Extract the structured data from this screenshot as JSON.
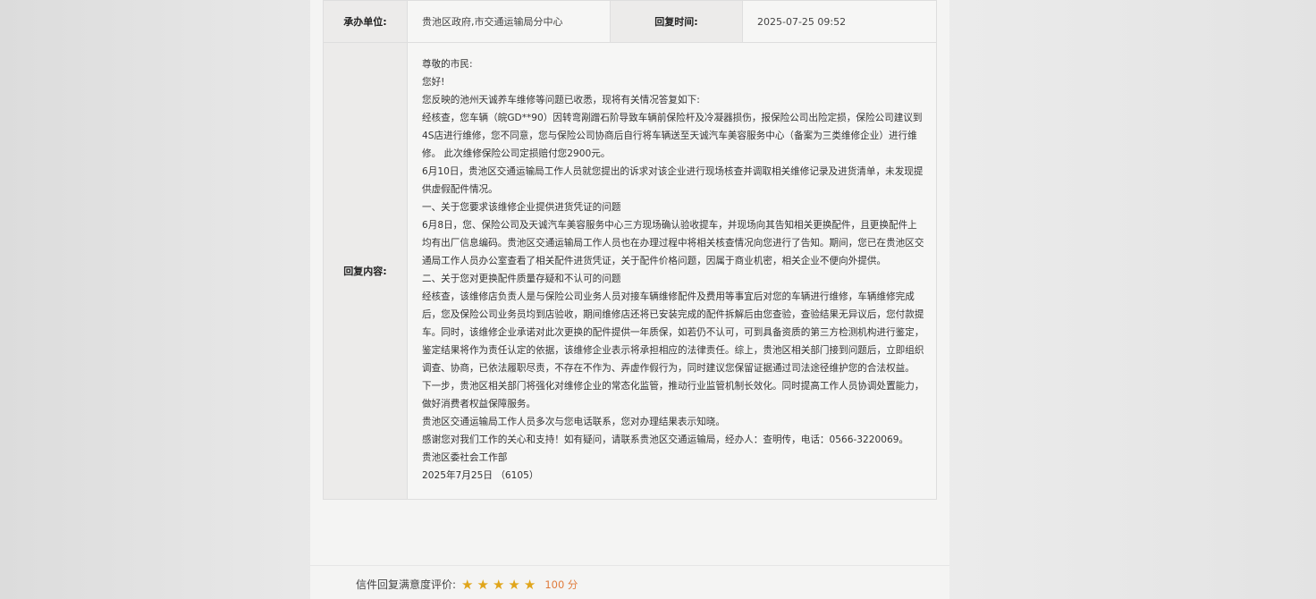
{
  "header_row": {
    "dept_label": "承办单位:",
    "dept_value": "贵池区政府,市交通运输局分中心",
    "time_label": "回复时间:",
    "time_value": "2025-07-25 09:52"
  },
  "reply": {
    "label": "回复内容:",
    "paragraphs": [
      "尊敬的市民:",
      "您好!",
      "您反映的池州天诚养车维修等问题已收悉，现将有关情况答复如下:",
      "经核查，您车辆（皖GD**90）因转弯剐蹭石阶导致车辆前保险杆及冷凝器损伤，报保险公司出险定损，保险公司建议到4S店进行维修，您不同意，您与保险公司协商后自行将车辆送至天诚汽车美容服务中心（备案为三类维修企业）进行维修。 此次维修保险公司定损赔付您2900元。",
      "6月10日，贵池区交通运输局工作人员就您提出的诉求对该企业进行现场核查并调取相关维修记录及进货清单，未发现提供虚假配件情况。",
      "一、关于您要求该维修企业提供进货凭证的问题",
      "6月8日，您、保险公司及天诚汽车美容服务中心三方现场确认验收提车，并现场向其告知相关更换配件，且更换配件上均有出厂信息编码。贵池区交通运输局工作人员也在办理过程中将相关核查情况向您进行了告知。期间，您已在贵池区交通局工作人员办公室查看了相关配件进货凭证，关于配件价格问题，因属于商业机密，相关企业不便向外提供。",
      "二、关于您对更换配件质量存疑和不认可的问题",
      "经核查，该维修店负责人是与保险公司业务人员对接车辆维修配件及费用等事宜后对您的车辆进行维修，车辆维修完成后，您及保险公司业务员均到店验收，期间维修店还将已安装完成的配件拆解后由您查验，查验结果无异议后，您付款提车。同时，该维修企业承诺对此次更换的配件提供一年质保，如若仍不认可，可到具备资质的第三方检测机构进行鉴定，鉴定结果将作为责任认定的依据，该维修企业表示将承担相应的法律责任。综上，贵池区相关部门接到问题后，立即组织调查、协商，已依法履职尽责，不存在不作为、弄虚作假行为，同时建议您保留证据通过司法途径维护您的合法权益。",
      "下一步，贵池区相关部门将强化对维修企业的常态化监管，推动行业监管机制长效化。同时提高工作人员协调处置能力，做好消费者权益保障服务。",
      "贵池区交通运输局工作人员多次与您电话联系，您对办理结果表示知晓。",
      "感谢您对我们工作的关心和支持！如有疑问，请联系贵池区交通运输局，经办人：查明传，电话：0566-3220069。",
      "贵池区委社会工作部",
      "2025年7月25日 （6105）"
    ]
  },
  "rating": {
    "label": "信件回复满意度评价:",
    "stars": 5,
    "star_color": "#e0a51b",
    "score_text": "100 分"
  }
}
